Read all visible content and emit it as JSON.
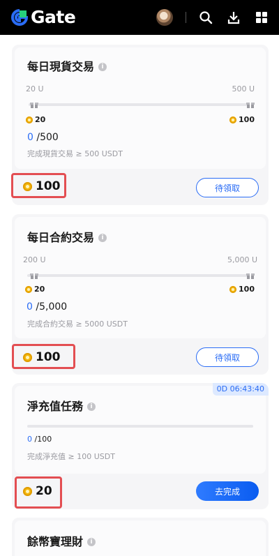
{
  "header": {
    "logo_text": "Gate",
    "icons": [
      "avatar",
      "search-icon",
      "download-icon",
      "grid-menu-icon"
    ]
  },
  "colors": {
    "accent": "#2a6cf5",
    "highlight": "#e34e52",
    "coin": "#f5b70c"
  },
  "tasks": [
    {
      "title": "每日現貨交易",
      "range_min": "20 U",
      "range_max": "500 U",
      "point_min": "20",
      "point_max": "100",
      "progress_current": "0",
      "progress_total": "/500",
      "description": "完成現貨交易 ≥ 500 USDT",
      "reward": "100",
      "button": "待領取"
    },
    {
      "title": "每日合約交易",
      "range_min": "200 U",
      "range_max": "5,000 U",
      "point_min": "20",
      "point_max": "100",
      "progress_current": "0",
      "progress_total": "/5,000",
      "description": "完成合約交易 ≥ 5000 USDT",
      "reward": "100",
      "button": "待領取"
    },
    {
      "title": "淨充值任務",
      "timer": "0D 06:43:40",
      "progress_current": "0",
      "progress_total": "/100",
      "description": "完成淨充值 ≥ 100 USDT",
      "reward": "20",
      "button": "去完成"
    },
    {
      "title": "餘幣寶理財"
    }
  ]
}
